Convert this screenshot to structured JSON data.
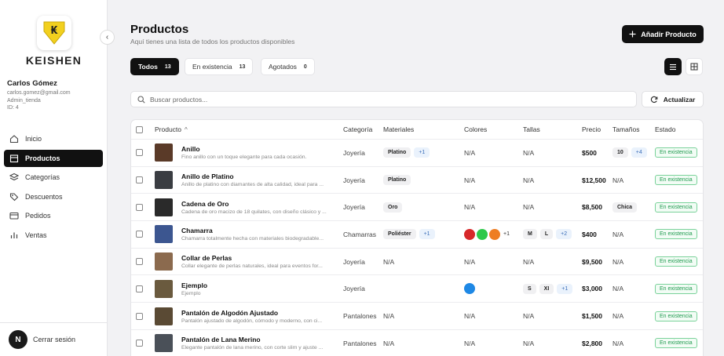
{
  "sidebar": {
    "brand": "KEISHEN",
    "collapse_icon": "‹",
    "user": {
      "name": "Carlos Gómez",
      "email": "carlos.gomez@gmail.com",
      "role": "Admin_tienda",
      "id": "ID: 4"
    },
    "nav": [
      {
        "label": "Inicio",
        "icon": "home-icon",
        "active": false
      },
      {
        "label": "Productos",
        "icon": "box-icon",
        "active": true
      },
      {
        "label": "Categorías",
        "icon": "layers-icon",
        "active": false
      },
      {
        "label": "Descuentos",
        "icon": "tag-icon",
        "active": false
      },
      {
        "label": "Pedidos",
        "icon": "card-icon",
        "active": false
      },
      {
        "label": "Ventas",
        "icon": "bar-chart-icon",
        "active": false
      }
    ],
    "logout": {
      "avatar_letter": "N",
      "label": "Cerrar sesión"
    }
  },
  "header": {
    "title": "Productos",
    "subtitle": "Aquí tienes una lista de todos los productos disponibles",
    "add_button": "Añadir Producto"
  },
  "tabs": [
    {
      "label": "Todos",
      "count": "13",
      "active": true
    },
    {
      "label": "En existencia",
      "count": "13",
      "active": false
    },
    {
      "label": "Agotados",
      "count": "0",
      "active": false
    }
  ],
  "search": {
    "placeholder": "Buscar productos..."
  },
  "refresh_label": "Actualizar",
  "table": {
    "headers": {
      "product": "Producto",
      "category": "Categoría",
      "materials": "Materiales",
      "colors": "Colores",
      "sizes": "Tallas",
      "price": "Precio",
      "dimensions": "Tamaños",
      "status": "Estado"
    },
    "sort_icon": "^",
    "rows": [
      {
        "name": "Anillo",
        "desc": "Fino anillo con un toque elegante para cada ocasión.",
        "category": "Joyería",
        "materials": [
          "Platino"
        ],
        "materials_more": "+1",
        "colors": [],
        "colors_na": "N/A",
        "colors_more": "",
        "sizes": [],
        "sizes_na": "N/A",
        "sizes_more": "",
        "price": "$500",
        "dims": [
          "10"
        ],
        "dims_more": "+4",
        "dims_na": "",
        "status": "En existencia",
        "thumb": "#5a3a28"
      },
      {
        "name": "Anillo de Platino",
        "desc": "Anillo de platino con diamantes de alta calidad, ideal para ...",
        "category": "Joyería",
        "materials": [
          "Platino"
        ],
        "materials_more": "",
        "colors": [],
        "colors_na": "N/A",
        "colors_more": "",
        "sizes": [],
        "sizes_na": "N/A",
        "sizes_more": "",
        "price": "$12,500",
        "dims": [],
        "dims_more": "",
        "dims_na": "N/A",
        "status": "En existencia",
        "thumb": "#3a3d42"
      },
      {
        "name": "Cadena de Oro",
        "desc": "Cadena de oro macizo de 18 quilates, con diseño clásico y ...",
        "category": "Joyería",
        "materials": [
          "Oro"
        ],
        "materials_more": "",
        "colors": [],
        "colors_na": "N/A",
        "colors_more": "",
        "sizes": [],
        "sizes_na": "N/A",
        "sizes_more": "",
        "price": "$8,500",
        "dims": [
          "Chica"
        ],
        "dims_more": "",
        "dims_na": "",
        "status": "En existencia",
        "thumb": "#2a2a2a"
      },
      {
        "name": "Chamarra",
        "desc": "Chamarra totalmente hecha con materiales biodegradable...",
        "category": "Chamarras",
        "materials": [
          "Poliéster"
        ],
        "materials_more": "+1",
        "colors": [
          "#d7282a",
          "#2ec84a",
          "#ee7d22"
        ],
        "colors_na": "",
        "colors_more": "+1",
        "sizes": [
          "M",
          "L"
        ],
        "sizes_na": "",
        "sizes_more": "+2",
        "price": "$400",
        "dims": [],
        "dims_more": "",
        "dims_na": "N/A",
        "status": "En existencia",
        "thumb": "#3c5690"
      },
      {
        "name": "Collar de Perlas",
        "desc": "Collar elegante de perlas naturales, ideal para eventos for...",
        "category": "Joyería",
        "materials": [],
        "materials_more": "",
        "colors": [],
        "colors_na": "N/A",
        "colors_more": "",
        "sizes": [],
        "sizes_na": "N/A",
        "sizes_more": "",
        "price": "$9,500",
        "dims": [],
        "dims_more": "",
        "dims_na": "N/A",
        "status": "En existencia",
        "thumb": "#8b6a4e"
      },
      {
        "name": "Ejemplo",
        "desc": "Ejemplo",
        "category": "Joyería",
        "materials": [],
        "materials_more": "",
        "colors": [
          "#1e88e5"
        ],
        "colors_na": "",
        "colors_more": "",
        "sizes": [
          "S",
          "XI"
        ],
        "sizes_na": "",
        "sizes_more": "+1",
        "price": "$3,000",
        "dims": [],
        "dims_more": "",
        "dims_na": "N/A",
        "status": "En existencia",
        "thumb": "#6a5a3e"
      },
      {
        "name": "Pantalón de Algodón Ajustado",
        "desc": "Pantalón ajustado de algodón, cómodo y moderno, con ci...",
        "category": "Pantalones",
        "materials": [],
        "materials_more": "",
        "colors": [],
        "colors_na": "N/A",
        "colors_more": "",
        "sizes": [],
        "sizes_na": "N/A",
        "sizes_more": "",
        "price": "$1,500",
        "dims": [],
        "dims_more": "",
        "dims_na": "N/A",
        "status": "En existencia",
        "thumb": "#5a4a34"
      },
      {
        "name": "Pantalón de Lana Merino",
        "desc": "Elegante pantalón de lana merino, con corte slim y ajuste ...",
        "category": "Pantalones",
        "materials": [],
        "materials_more": "",
        "colors": [],
        "colors_na": "N/A",
        "colors_more": "",
        "sizes": [],
        "sizes_na": "N/A",
        "sizes_more": "",
        "price": "$2,800",
        "dims": [],
        "dims_more": "",
        "dims_na": "N/A",
        "status": "En existencia",
        "thumb": "#4a5058"
      }
    ]
  },
  "colors": {
    "accent": "#111111",
    "success": "#1f9a4e",
    "logo_yellow": "#f2d01e"
  }
}
